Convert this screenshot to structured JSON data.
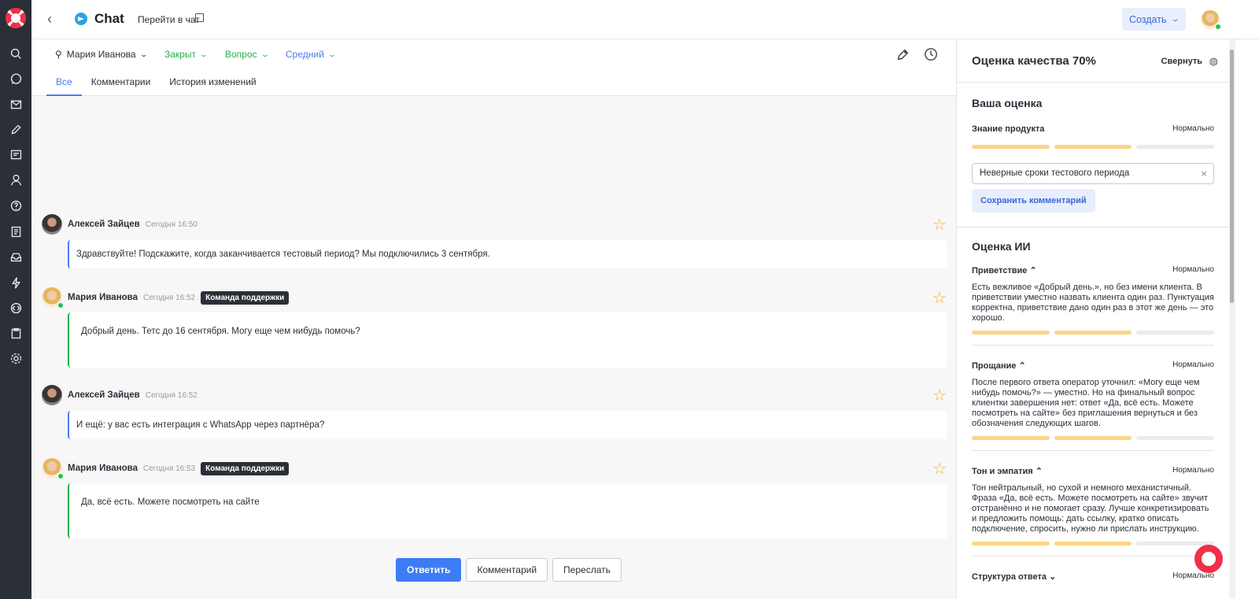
{
  "header": {
    "title": "Chat",
    "goto_chat": "Перейти в чат",
    "create_button": "Создать"
  },
  "filters": {
    "assignee": "Мария Иванова",
    "status": "Закрыт",
    "type": "Вопрос",
    "priority": "Средний"
  },
  "tabs": [
    "Все",
    "Комментарии",
    "История изменений"
  ],
  "messages": [
    {
      "author": "Алексей Зайцев",
      "time": "Сегодня 16:50",
      "text": "Здравствуйте! Подскажите, когда заканчивается тестовый период? Мы подключились 3 сентября."
    },
    {
      "author": "Мария Иванова",
      "time": "Сегодня 16:52",
      "badge": "Команда поддержки",
      "text": "Добрый день. Тетс до 16 сентября. Могу еще чем нибудь помочь?"
    },
    {
      "author": "Алексей Зайцев",
      "time": "Сегодня 16:52",
      "text": "И ещё: у вас есть интеграция с WhatsApp через партнёра?"
    },
    {
      "author": "Мария Иванова",
      "time": "Сегодня 16:53",
      "badge": "Команда поддержки",
      "text": "Да, всё есть. Можете посмотреть на сайте"
    }
  ],
  "actions": {
    "reply": "Ответить",
    "comment": "Комментарий",
    "forward": "Переслать"
  },
  "panel": {
    "title": "Оценка качества 70%",
    "collapse": "Свернуть",
    "your_rating": {
      "title": "Ваша оценка",
      "criterion": "Знание продукта",
      "level": "Нормально",
      "score": 2,
      "max": 3,
      "comment_value": "Неверные сроки тестового периода",
      "save_button": "Сохранить комментарий"
    },
    "ai_rating": {
      "title": "Оценка ИИ",
      "items": [
        {
          "name": "Приветствие",
          "level": "Нормально",
          "score": 2,
          "max": 3,
          "text": "Есть вежливое «Добрый день.», но без имени клиента. В приветствии уместно назвать клиента один раз. Пунктуация корректна, приветствие дано один раз в этот же день — это хорошо."
        },
        {
          "name": "Прощание",
          "level": "Нормально",
          "score": 2,
          "max": 3,
          "text": "После первого ответа оператор уточнил: «Могу еще чем нибудь помочь?» — уместно. Но на финальный вопрос клиентки завершения нет: ответ «Да, всё есть. Можете посмотреть на сайте» без приглашения вернуться и без обозначения следующих шагов."
        },
        {
          "name": "Тон и эмпатия",
          "level": "Нормально",
          "score": 2,
          "max": 3,
          "text": "Тон нейтральный, но сухой и немного механистичный. Фраза «Да, всё есть. Можете посмотреть на сайте» звучит отстранённо и не помогает сразу. Лучше конкретизировать и предложить помощь: дать ссылку, кратко описать подключение, спросить, нужно ли прислать инструкцию."
        },
        {
          "name": "Структура ответа",
          "level": "Нормально"
        }
      ]
    }
  }
}
